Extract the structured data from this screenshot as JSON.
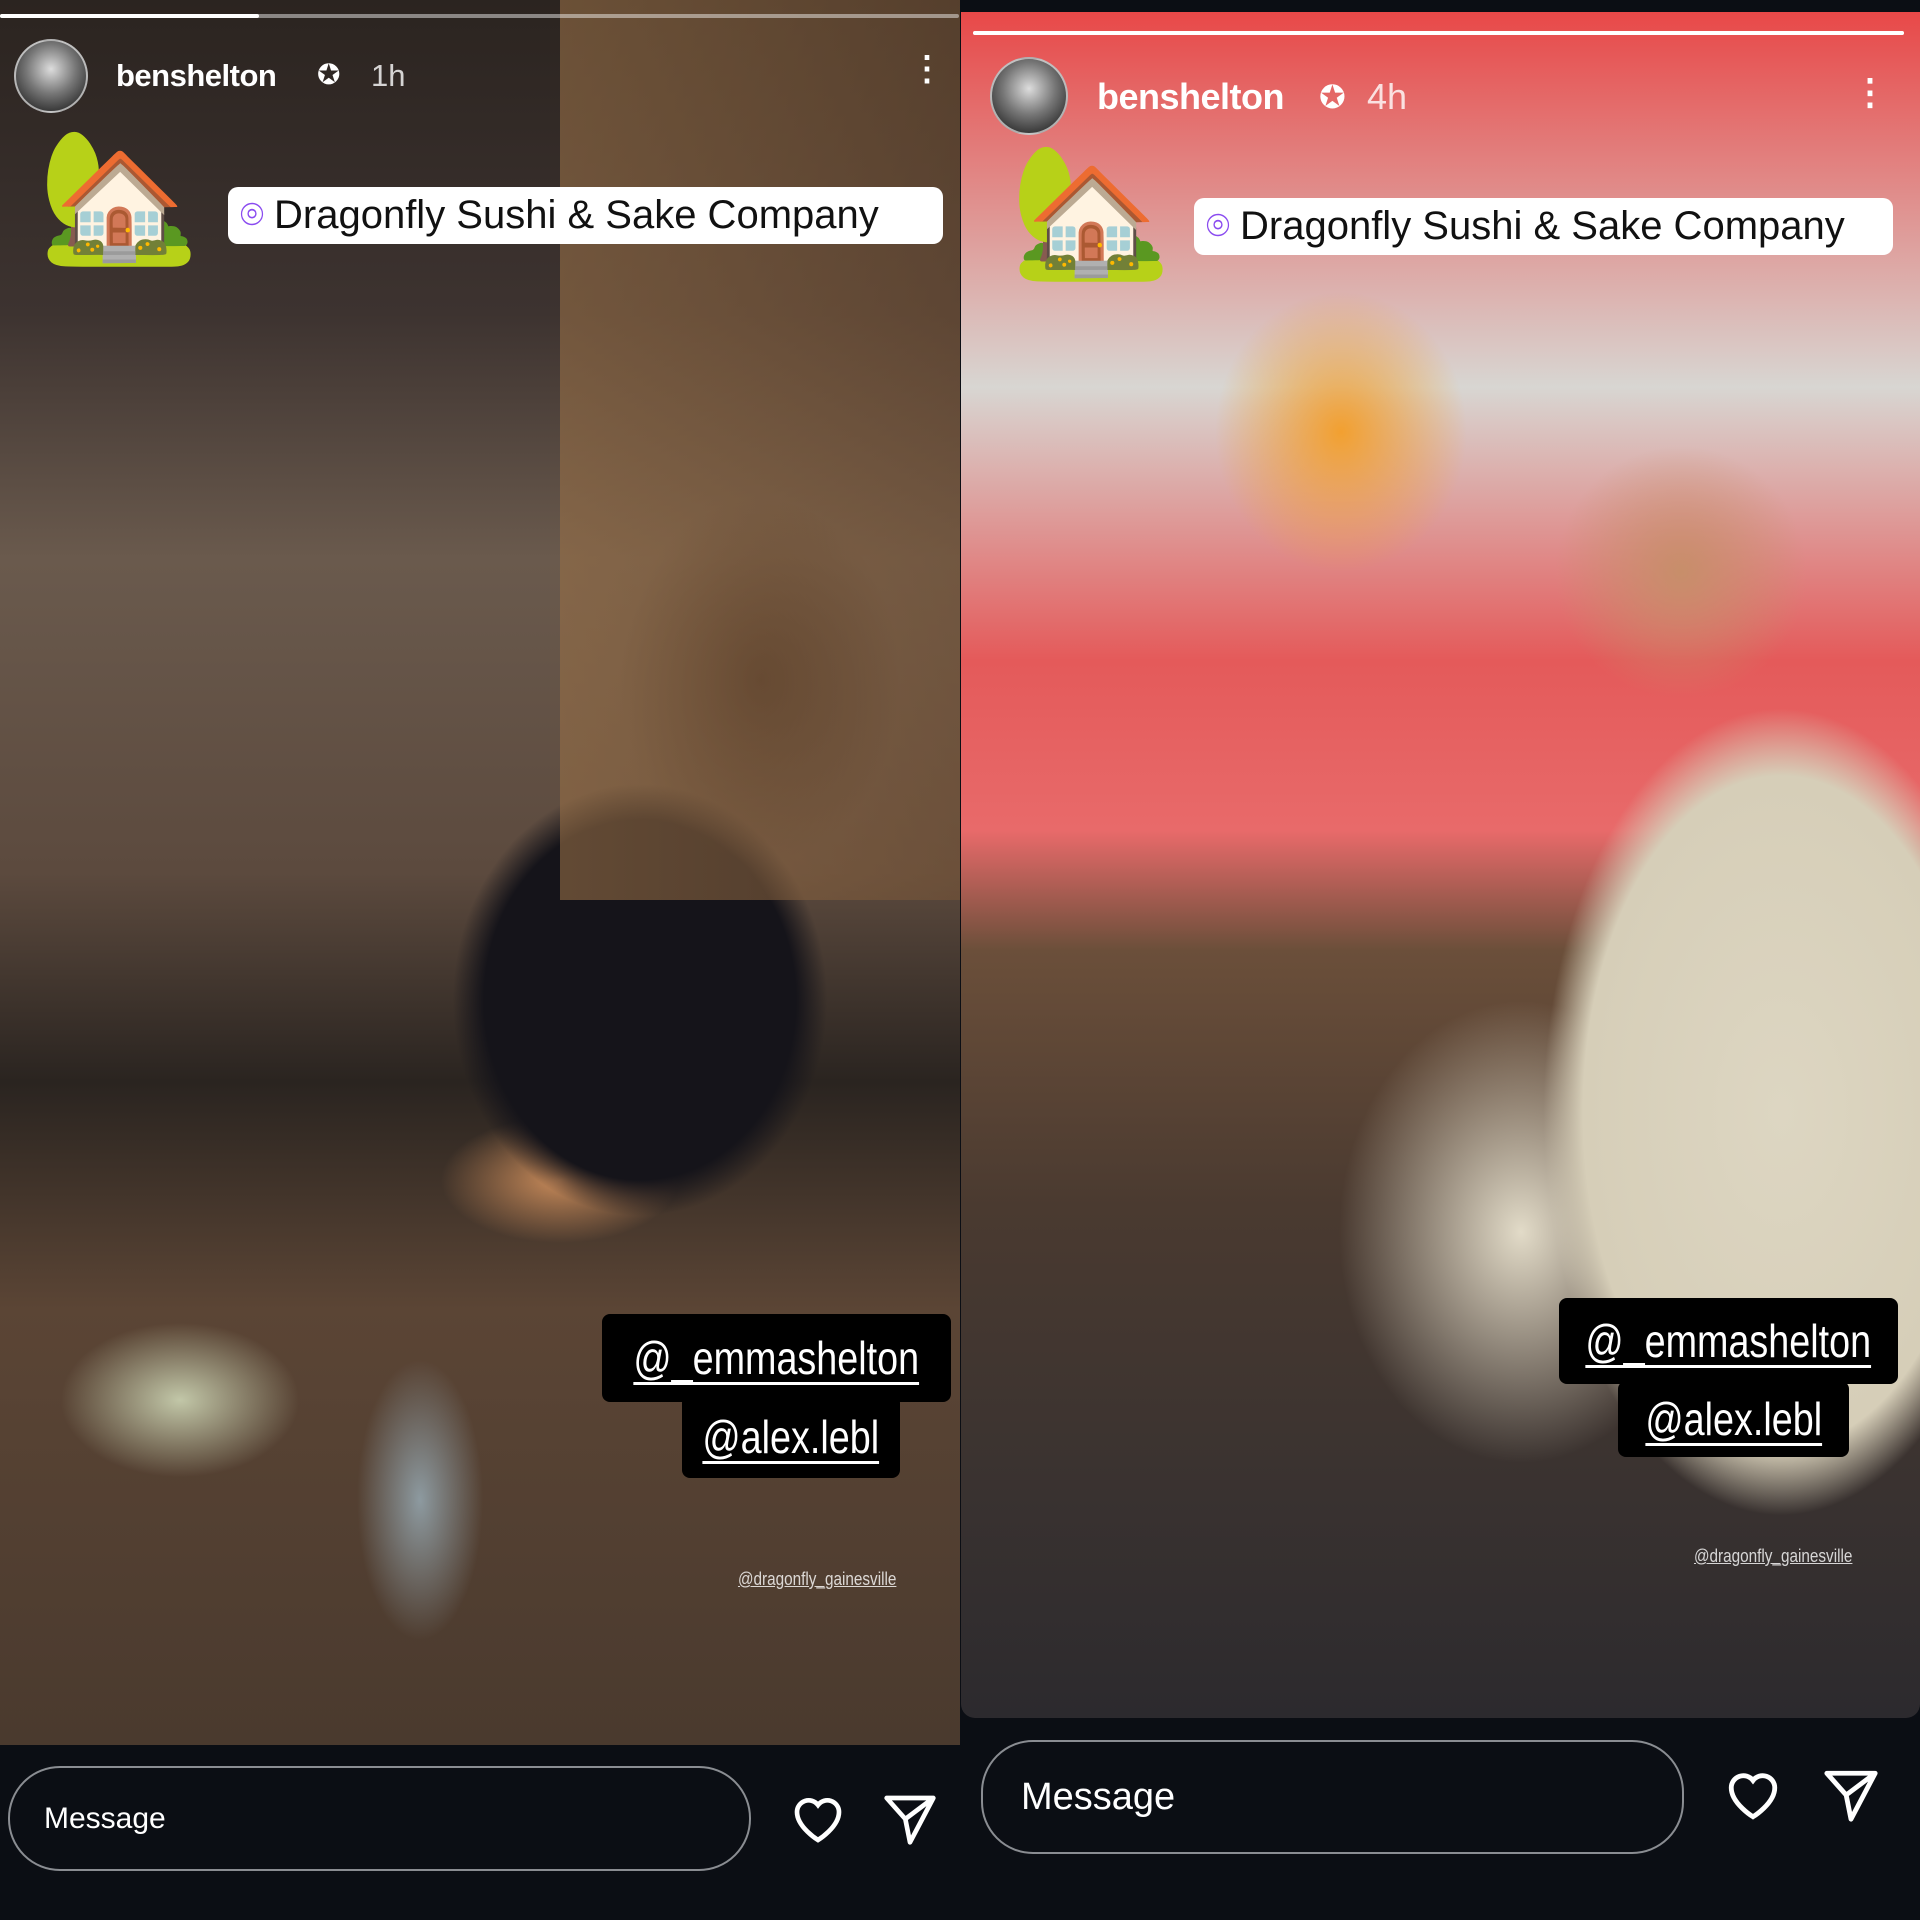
{
  "stories": [
    {
      "username": "benshelton",
      "verified_icon": "verified-badge-icon",
      "time": "1h",
      "progress": 0.27,
      "location": "Dragonfly Sushi & Sake Company",
      "sticker_icon": "house-with-garden-emoji",
      "mentions": [
        "@_emmashelton",
        "@alex.lebl"
      ],
      "watermark": "@dragonfly_gainesville",
      "message_placeholder": "Message"
    },
    {
      "username": "benshelton",
      "verified_icon": "verified-badge-icon",
      "time": "4h",
      "progress": 1.0,
      "location": "Dragonfly Sushi & Sake Company",
      "sticker_icon": "house-with-garden-emoji",
      "mentions": [
        "@_emmashelton",
        "@alex.lebl"
      ],
      "watermark": "@dragonfly_gainesville",
      "message_placeholder": "Message"
    }
  ],
  "icons": {
    "more": "more-vertical-icon",
    "like": "heart-icon",
    "send": "paper-plane-icon",
    "pin": "location-pin-icon"
  },
  "colors": {
    "background": "#0b0e14",
    "location_pin": "#8a4bf0",
    "tag_bg": "#000000"
  }
}
